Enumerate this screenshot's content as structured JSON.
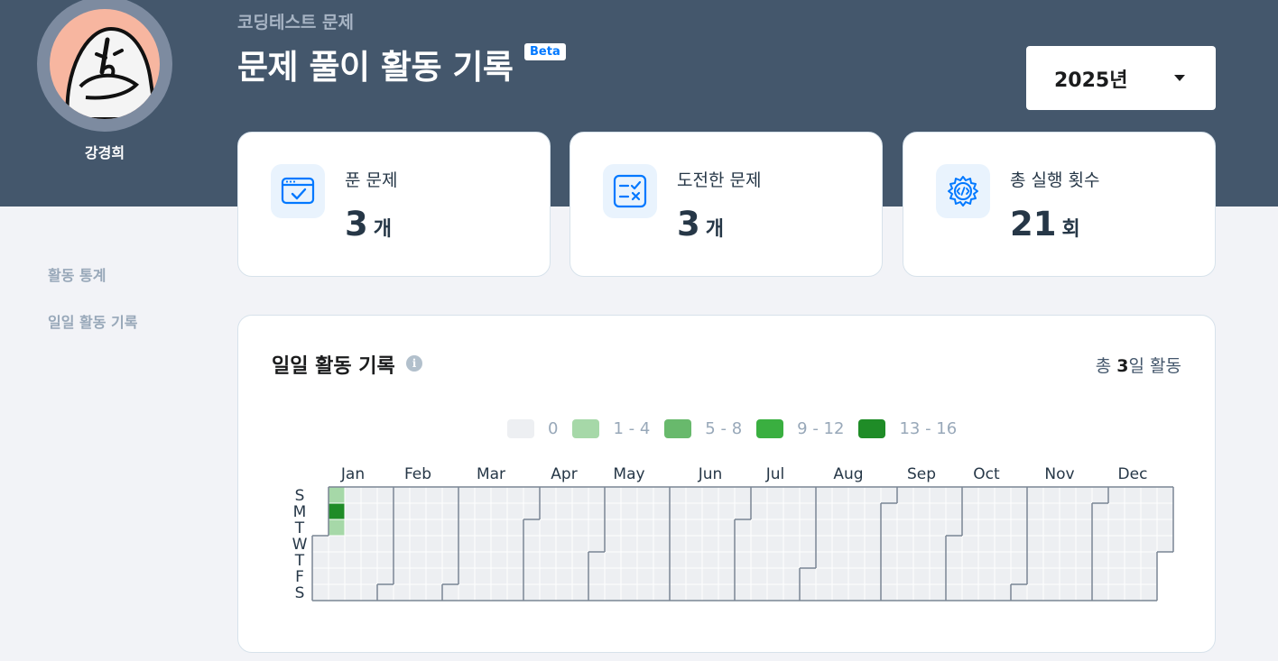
{
  "profile": {
    "username": "강경희"
  },
  "header": {
    "subtitle": "코딩테스트 문제",
    "title": "문제 풀이 활동 기록",
    "beta_badge": "Beta",
    "year_select": {
      "selected": "2025년"
    }
  },
  "stats": [
    {
      "label": "푼 문제",
      "value": "3",
      "unit": "개",
      "icon": "browser-check-icon"
    },
    {
      "label": "도전한 문제",
      "value": "3",
      "unit": "개",
      "icon": "checklist-icon"
    },
    {
      "label": "총 실행 횟수",
      "value": "21",
      "unit": "회",
      "icon": "gear-code-icon"
    }
  ],
  "sidebar": {
    "items": [
      {
        "label": "활동 통계"
      },
      {
        "label": "일일 활동 기록"
      }
    ]
  },
  "activity": {
    "title": "일일 활동 기록",
    "total_prefix": "총 ",
    "total_days": "3",
    "total_suffix": "일 활동",
    "legend": [
      {
        "label": "0",
        "color": "#edeff2"
      },
      {
        "label": "1 - 4",
        "color": "#a6d8a8"
      },
      {
        "label": "5 - 8",
        "color": "#68b96c"
      },
      {
        "label": "9 - 12",
        "color": "#3aaf40"
      },
      {
        "label": "13 - 16",
        "color": "#1f8c27"
      }
    ],
    "months": [
      "Jan",
      "Feb",
      "Mar",
      "Apr",
      "May",
      "Jun",
      "Jul",
      "Aug",
      "Sep",
      "Oct",
      "Nov",
      "Dec"
    ],
    "weekdays": [
      "S",
      "M",
      "T",
      "W",
      "T",
      "F",
      "S"
    ],
    "year": 2025,
    "active_days": [
      {
        "date": "2025-01-05",
        "level": 1
      },
      {
        "date": "2025-01-06",
        "level": 4
      },
      {
        "date": "2025-01-07",
        "level": 1
      }
    ]
  },
  "colors": {
    "header_bg": "#44576c",
    "accent_blue": "#0078ff",
    "empty_cell": "#edeff2"
  }
}
